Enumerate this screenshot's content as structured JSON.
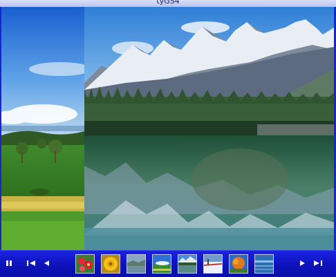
{
  "window": {
    "title": "tyGS4"
  },
  "viewer": {
    "current_slide": "mountain-lake",
    "previous_slide": "green-meadow"
  },
  "controls": {
    "pause_icon": "pause-icon",
    "first_icon": "skip-first-icon",
    "prev_icon": "previous-icon",
    "next_icon": "next-icon",
    "last_icon": "skip-last-icon"
  },
  "thumbnails": [
    {
      "subject": "red-flowers"
    },
    {
      "subject": "yellow-flower"
    },
    {
      "subject": "coastal-hills"
    },
    {
      "subject": "meadow-sky"
    },
    {
      "subject": "mountain-lake"
    },
    {
      "subject": "snowy-field"
    },
    {
      "subject": "autumn-tree"
    },
    {
      "subject": "blue-water"
    }
  ],
  "colors": {
    "frame_blue": "#1b21d8",
    "control_bar": "#0c12b6"
  }
}
